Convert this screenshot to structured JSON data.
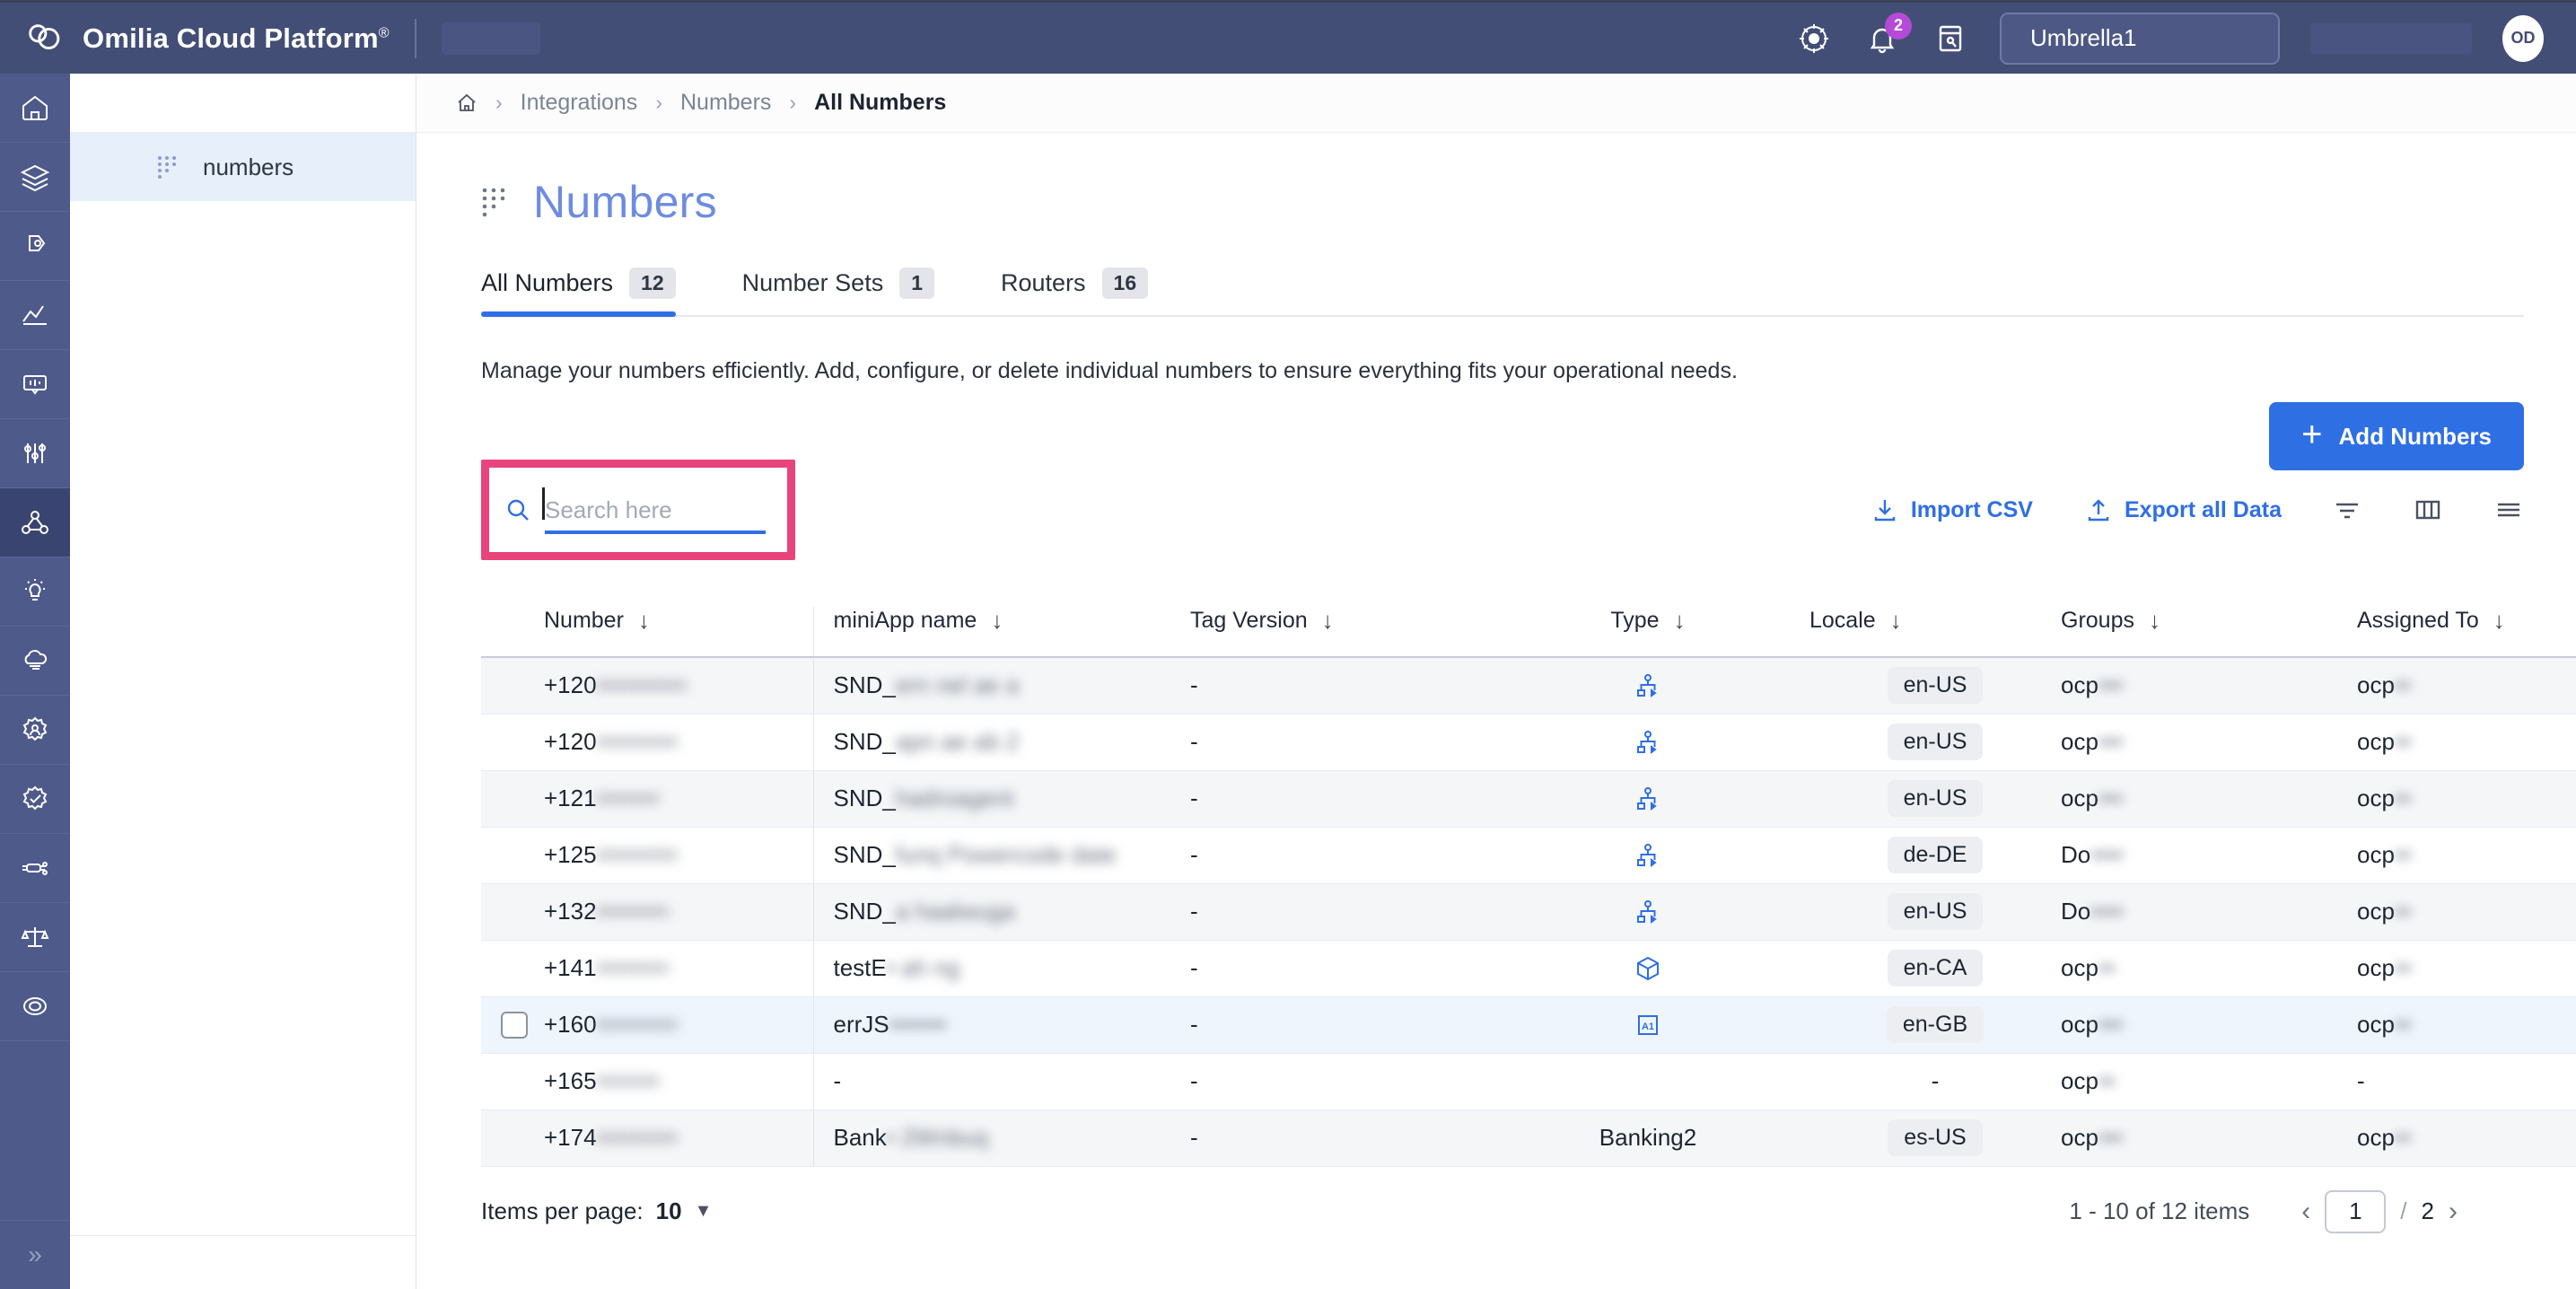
{
  "topbar": {
    "brand": "Omilia Cloud Platform",
    "brand_mark": "®",
    "tenant": "Umbrella1",
    "notification_badge": "2",
    "avatar_initials": "OD",
    "icons": [
      "help-icon",
      "notification-bell-icon",
      "notes-icon"
    ]
  },
  "rail": {
    "items": [
      {
        "name": "home"
      },
      {
        "name": "layers"
      },
      {
        "name": "voice-tag"
      },
      {
        "name": "analytics"
      },
      {
        "name": "conversations"
      },
      {
        "name": "tuning"
      },
      {
        "name": "integrations"
      },
      {
        "name": "insights"
      },
      {
        "name": "cloud"
      },
      {
        "name": "identity"
      },
      {
        "name": "verification"
      },
      {
        "name": "automation"
      },
      {
        "name": "compliance"
      },
      {
        "name": "support"
      }
    ],
    "active_index": 6,
    "collapse_label": "»"
  },
  "subnav": {
    "item_label": "numbers"
  },
  "breadcrumb": {
    "home_icon": "home-icon",
    "items": [
      "Integrations",
      "Numbers",
      "All Numbers"
    ],
    "separator": "›"
  },
  "page": {
    "title": "Numbers",
    "description": "Manage your numbers efficiently. Add, configure, or delete individual numbers to ensure everything fits your operational needs."
  },
  "tabs": [
    {
      "label": "All Numbers",
      "count": "12",
      "active": true
    },
    {
      "label": "Number Sets",
      "count": "1",
      "active": false
    },
    {
      "label": "Routers",
      "count": "16",
      "active": false
    }
  ],
  "add_button": {
    "label": "Add Numbers",
    "plus": "+"
  },
  "search": {
    "placeholder": "Search here",
    "value": "",
    "highlight_color": "#e8447b"
  },
  "toolbar": {
    "import_label": "Import CSV",
    "export_label": "Export all Data",
    "icons": [
      "filter-icon",
      "columns-icon",
      "menu-icon"
    ]
  },
  "table": {
    "sort_glyph": "↓",
    "columns": [
      "Number",
      "miniApp name",
      "Tag Version",
      "Type",
      "Locale",
      "Groups",
      "Assigned To"
    ],
    "rows": [
      {
        "number": "+120",
        "number_blur": "••••••••••",
        "miniapp": "SND_",
        "miniapp_blur": "ern nel ae a",
        "tag": "-",
        "type_icon": "sitemap-icon",
        "type_text": "",
        "locale": "en-US",
        "group": "ocp",
        "group_blur": "•••",
        "assigned": "ocp",
        "assigned_blur": "••",
        "selected": false
      },
      {
        "number": "+120",
        "number_blur": "•••••••••",
        "miniapp": "SND_",
        "miniapp_blur": "apn ae ab 2",
        "tag": "-",
        "type_icon": "sitemap-icon",
        "type_text": "",
        "locale": "en-US",
        "group": "ocp",
        "group_blur": "•••",
        "assigned": "ocp",
        "assigned_blur": "••",
        "selected": false
      },
      {
        "number": "+121",
        "number_blur": "•••••••",
        "miniapp": "SND_",
        "miniapp_blur": "hadroagent",
        "tag": "-",
        "type_icon": "sitemap-icon",
        "type_text": "",
        "locale": "en-US",
        "group": "ocp",
        "group_blur": "•••",
        "assigned": "ocp",
        "assigned_blur": "••",
        "selected": false
      },
      {
        "number": "+125",
        "number_blur": "•••••••••",
        "miniapp": "SND_",
        "miniapp_blur": "funq Powercode date",
        "tag": "-",
        "type_icon": "sitemap-icon",
        "type_text": "",
        "locale": "de-DE",
        "group": "Do",
        "group_blur": "••••",
        "assigned": "ocp",
        "assigned_blur": "••",
        "selected": false
      },
      {
        "number": "+132",
        "number_blur": "••••••••",
        "miniapp": "SND_",
        "miniapp_blur": "a haalwuga",
        "tag": "-",
        "type_icon": "sitemap-icon",
        "type_text": "",
        "locale": "en-US",
        "group": "Do",
        "group_blur": "••••",
        "assigned": "ocp",
        "assigned_blur": "••",
        "selected": false
      },
      {
        "number": "+141",
        "number_blur": "••••••••",
        "miniapp": "testE",
        "miniapp_blur": "• ah ng",
        "tag": "-",
        "type_icon": "cube-icon",
        "type_text": "",
        "locale": "en-CA",
        "group": "ocp",
        "group_blur": "••",
        "assigned": "ocp",
        "assigned_blur": "••",
        "selected": false
      },
      {
        "number": "+160",
        "number_blur": "•••••••••",
        "miniapp": "errJS",
        "miniapp_blur": "•••••••",
        "tag": "-",
        "type_icon": "a1-box-icon",
        "type_text": "",
        "locale": "en-GB",
        "group": "ocp",
        "group_blur": "•••",
        "assigned": "ocp",
        "assigned_blur": "••",
        "selected": true
      },
      {
        "number": "+165",
        "number_blur": "•••••••",
        "miniapp": "-",
        "miniapp_blur": "",
        "tag": "-",
        "type_icon": "",
        "type_text": "",
        "locale": "-",
        "group": "ocp",
        "group_blur": "••",
        "assigned": "-",
        "assigned_blur": "",
        "selected": false
      },
      {
        "number": "+174",
        "number_blur": "•••••••••",
        "miniapp": "Bank",
        "miniapp_blur": "• 2Wnbuq",
        "tag": "-",
        "type_icon": "",
        "type_text": "Banking2",
        "locale": "es-US",
        "group": "ocp",
        "group_blur": "•••",
        "assigned": "ocp",
        "assigned_blur": "••",
        "selected": false
      }
    ]
  },
  "footer": {
    "items_per_page_label": "Items per page:",
    "items_per_page_value": "10",
    "range_text": "1 - 10 of 12 items",
    "current_page": "1",
    "total_pages": "2",
    "prev_glyph": "‹",
    "next_glyph": "›",
    "page_sep": "/"
  }
}
